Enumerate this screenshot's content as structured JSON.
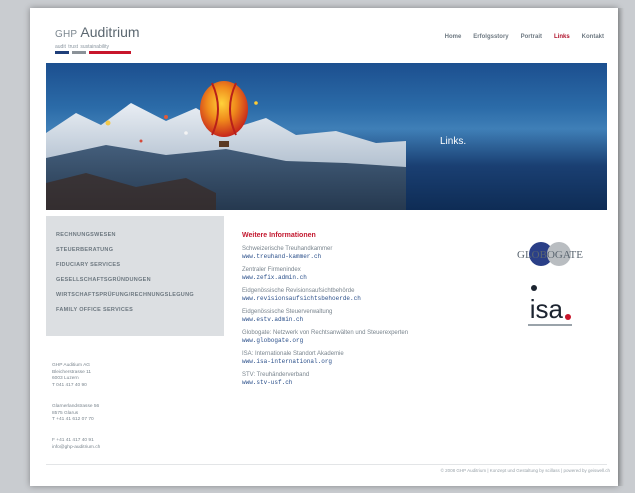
{
  "logo": {
    "prefix": "GHP",
    "name": "Auditrium",
    "tagline": "audit trust sustainability"
  },
  "nav": {
    "items": [
      "Home",
      "Erfolgsstory",
      "Portrait",
      "Links",
      "Kontakt"
    ],
    "active": "Links"
  },
  "hero": {
    "title": "Links."
  },
  "sidebar": {
    "items": [
      "Rechnungswesen",
      "Steuerberatung",
      "Fiduciary Services",
      "Gesellschaftsgründungen",
      "Wirtschaftsprüfung/Rechnungslegung",
      "Family Office Services"
    ]
  },
  "address": {
    "company": "GHP Auditium AG",
    "street1": "Bleicherstrasse 11",
    "city1": "6003 Luzern",
    "phone1": "T 041 417 40 90",
    "street2": "Glarnerlandstrasse 56",
    "city2": "8575 Glarus",
    "phone2": "T +41 41 612 07 70",
    "fax": "F +41 41 417 40 91",
    "email": "info@ghp-auditrium.ch"
  },
  "content": {
    "heading": "Weitere Informationen",
    "entries": [
      {
        "desc": "Schweizerische Treuhandkammer",
        "link": "www.treuhand-kammer.ch"
      },
      {
        "desc": "Zentraler Firmenindex",
        "link": "www.zefix.admin.ch"
      },
      {
        "desc": "Eidgenössische Revisionsaufsichtbehörde",
        "link": "www.revisionsaufsichtsbehoerde.ch"
      },
      {
        "desc": "Eidgenössische Steuerverwaltung",
        "link": "www.estv.admin.ch"
      },
      {
        "desc": "Globogate: Netzwerk von Rechtsanwälten und Steuerexperten",
        "link": "www.globogate.org"
      },
      {
        "desc": "ISA: Internationale Standort Akademie",
        "link": "www.isa-international.org"
      },
      {
        "desc": "STV: Treuhänderverband",
        "link": "www.stv-usf.ch"
      }
    ]
  },
  "partners": {
    "globogate": "GLOBOGATE",
    "isa": "isa."
  },
  "footer": {
    "text": "© 2008 GHP Auditrium | Konzept und Gestaltung by scillass | powered by geiswell.ch"
  },
  "colors": {
    "accent_red": "#c3182f",
    "link_blue": "#2a4f8a",
    "sidebar_bg": "#dcdfe2"
  }
}
